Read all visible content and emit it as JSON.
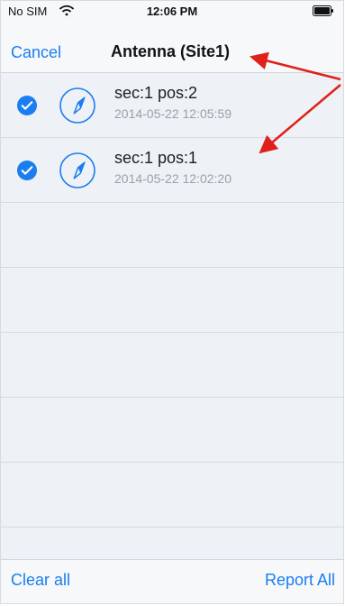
{
  "status_bar": {
    "carrier": "No SIM",
    "time": "12:06 PM"
  },
  "nav": {
    "cancel_label": "Cancel",
    "title": "Antenna (Site1)"
  },
  "records": [
    {
      "title": "sec:1  pos:2",
      "timestamp": "2014-05-22 12:05:59",
      "selected": true
    },
    {
      "title": "sec:1  pos:1",
      "timestamp": "2014-05-22 12:02:20",
      "selected": true
    }
  ],
  "toolbar": {
    "clear_label": "Clear all",
    "report_label": "Report All"
  },
  "colors": {
    "accent": "#1a7ef0",
    "annotation": "#e0201b"
  },
  "icons": {
    "wifi": "wifi-icon",
    "battery": "battery-icon",
    "selected": "checkmark-circle-icon",
    "antenna": "compass-icon"
  }
}
